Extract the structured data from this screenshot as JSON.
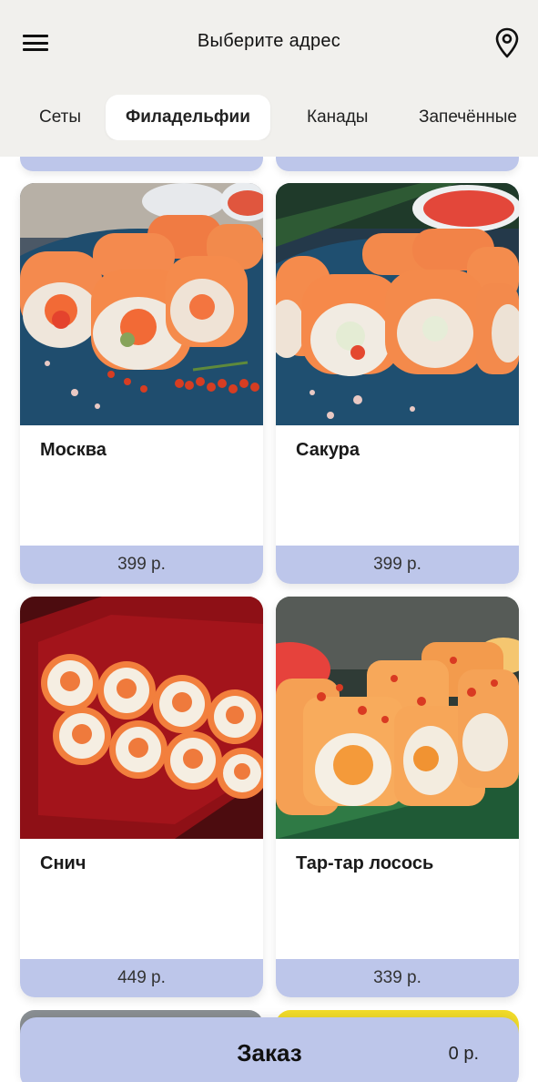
{
  "header": {
    "title": "Выберите адрес",
    "menu_icon": "hamburger-menu-icon",
    "location_icon": "map-pin-icon"
  },
  "tabs": [
    {
      "label": "Сеты",
      "active": false
    },
    {
      "label": "Филадельфии",
      "active": true
    },
    {
      "label": "Канады",
      "active": false
    },
    {
      "label": "Запечённые",
      "active": false
    }
  ],
  "products": [
    {
      "name": "Москва",
      "price": "399 р."
    },
    {
      "name": "Сакура",
      "price": "399 р."
    },
    {
      "name": "Снич",
      "price": "449 р."
    },
    {
      "name": "Тар-тар лосось",
      "price": "339 р."
    }
  ],
  "order": {
    "label": "Заказ",
    "total": "0 р."
  },
  "colors": {
    "header_bg": "#f1f0ed",
    "price_bar": "#bdc6ea",
    "order_bar": "#bdc6ea"
  }
}
